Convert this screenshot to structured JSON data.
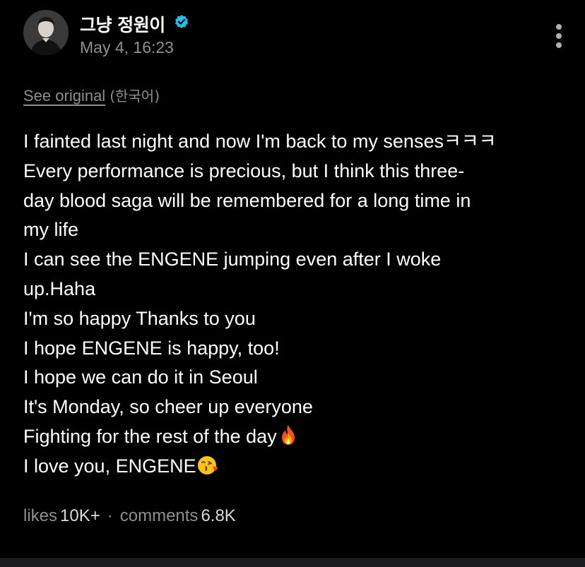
{
  "author": {
    "name": "그냥 정원이",
    "verified": true,
    "timestamp": "May 4, 16:23",
    "avatar_icon": "profile-photo"
  },
  "translation": {
    "see_original_label": "See original",
    "language_note": "(한국어)"
  },
  "post": {
    "lines": [
      "I fainted last night and now I'm back to my sensesㅋㅋㅋ",
      "Every performance is precious, but I think this three-",
      "day blood saga will be remembered for a long time in",
      "my life",
      "I can see the ENGENE jumping even after I woke",
      "up.Haha",
      "I'm so happy Thanks to you",
      "I hope ENGENE is happy, too!",
      "I hope we can do it in Seoul",
      "It's Monday, so cheer up everyone",
      "Fighting for the rest of the day",
      "I love you, ENGENE"
    ],
    "emoji_line_10": "fire-emoji",
    "emoji_line_11": "kissing-heart-emoji"
  },
  "stats": {
    "likes_label": "likes",
    "likes_value": "10K+",
    "separator": "·",
    "comments_label": "comments",
    "comments_value": "6.8K"
  },
  "colors": {
    "background": "#000000",
    "text": "#ffffff",
    "muted": "#8e8e93",
    "verified_badge": "#1fc0f0"
  }
}
